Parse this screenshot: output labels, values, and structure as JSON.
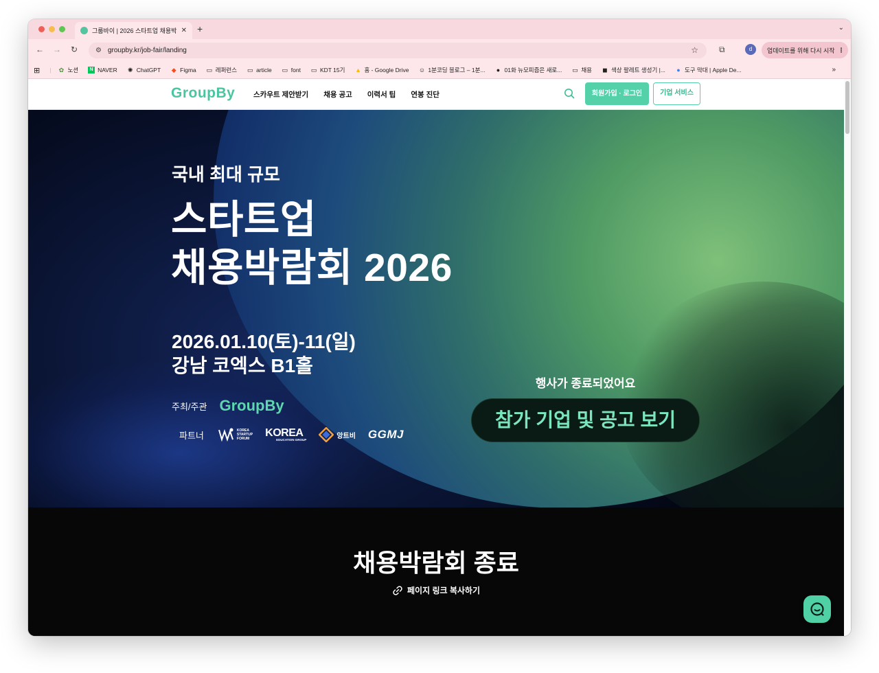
{
  "browser": {
    "tab_title": "그룹바이 | 2026 스타트업 채용박",
    "url": "groupby.kr/job-fair/landing",
    "profile_initial": "d",
    "update_button": "업데이트를 위해 다시 시작",
    "bookmarks": [
      {
        "label": "노션",
        "icon": "sprout-icon"
      },
      {
        "label": "NAVER",
        "icon": "naver-icon"
      },
      {
        "label": "ChatGPT",
        "icon": "chatgpt-icon"
      },
      {
        "label": "Figma",
        "icon": "figma-icon"
      },
      {
        "label": "레퍼런스",
        "icon": "folder-icon"
      },
      {
        "label": "article",
        "icon": "folder-icon"
      },
      {
        "label": "font",
        "icon": "folder-icon"
      },
      {
        "label": "KDT 15기",
        "icon": "folder-icon"
      },
      {
        "label": "홈 - Google Drive",
        "icon": "drive-icon"
      },
      {
        "label": "1분코딩 블로그 – 1분...",
        "icon": "blog-icon"
      },
      {
        "label": "01화 뉴모피즘은 새로...",
        "icon": "brunch-icon"
      },
      {
        "label": "채용",
        "icon": "folder-icon"
      },
      {
        "label": "색상 팔레트 생성기 |...",
        "icon": "palette-icon"
      },
      {
        "label": "도구 막대 | Apple De...",
        "icon": "apple-icon"
      }
    ]
  },
  "gnb": {
    "logo": "GroupBy",
    "menu": [
      "스카우트 제안받기",
      "채용 공고",
      "이력서 팁",
      "연봉 진단"
    ],
    "login_button": "회원가입 · 로그인",
    "corp_button": "기업 서비스"
  },
  "hero": {
    "subtitle": "국내 최대 규모",
    "title_line1": "스타트업",
    "title_line2": "채용박람회 2026",
    "date": "2026.01.10(토)-11(일)",
    "venue": "강남 코엑스 B1홀",
    "host_label": "주최/주관",
    "host_logo": "GroupBy",
    "partner_label": "파트너",
    "partners": {
      "ksf_line1": "KOREA",
      "ksf_line2": "STARTUP",
      "ksf_line3": "FORUM",
      "korea_edu": "KOREA",
      "korea_edu_sub": "EDUCATION GROUP",
      "antb": "앙트비",
      "ggmj": "GGMJ"
    },
    "ended_text": "행사가 종료되었어요",
    "cta": "참가 기업 및 공고 보기"
  },
  "section": {
    "title": "채용박람회 종료",
    "copy_link": "페이지 링크 복사하기"
  },
  "colors": {
    "brand": "#55d1a9",
    "tab_strip": "#f7d9df"
  }
}
